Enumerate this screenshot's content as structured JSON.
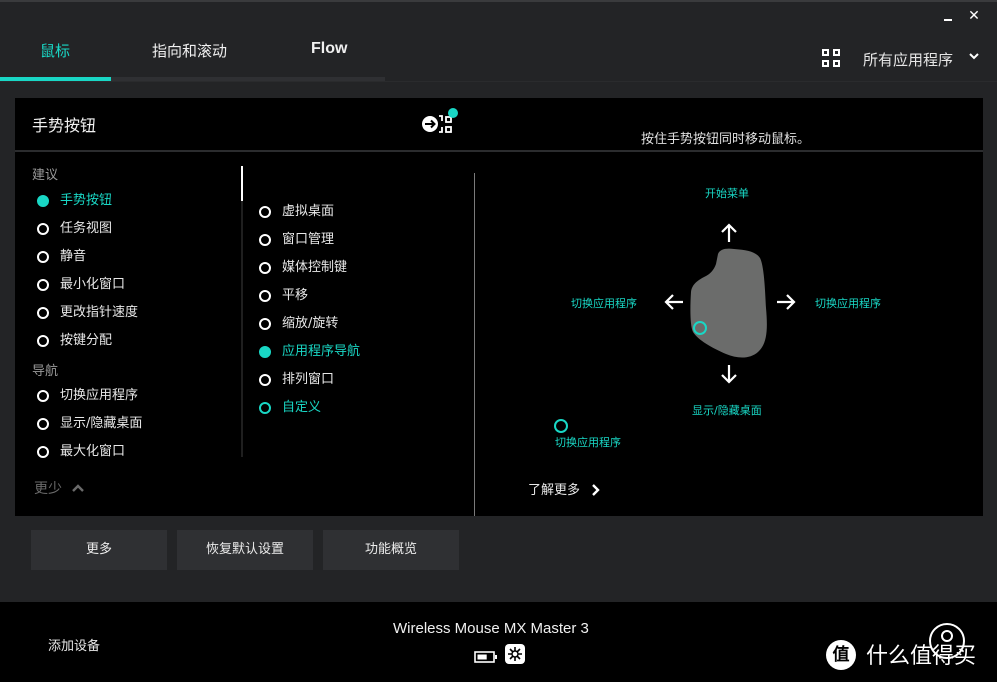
{
  "window": {
    "minimize_label": "minimize",
    "close_label": "✕"
  },
  "tabs": [
    {
      "label": "鼠标",
      "active": true
    },
    {
      "label": "指向和滚动",
      "active": false
    },
    {
      "label": "Flow",
      "active": false
    }
  ],
  "app_selector": {
    "label": "所有应用程序",
    "icon": "app-grid-icon",
    "chevron": "⌄"
  },
  "panel": {
    "title": "手势按钮",
    "hint": "按住手势按钮同时移动鼠标。",
    "left_list": {
      "sections": [
        {
          "label": "建议",
          "items": [
            {
              "label": "手势按钮",
              "selected": true
            },
            {
              "label": "任务视图",
              "selected": false
            },
            {
              "label": "静音",
              "selected": false
            },
            {
              "label": "最小化窗口",
              "selected": false
            },
            {
              "label": "更改指针速度",
              "selected": false
            },
            {
              "label": "按键分配",
              "selected": false
            }
          ]
        },
        {
          "label": "导航",
          "items": [
            {
              "label": "切换应用程序",
              "selected": false
            },
            {
              "label": "显示/隐藏桌面",
              "selected": false
            },
            {
              "label": "最大化窗口",
              "selected": false
            }
          ]
        }
      ],
      "less_label": "更少"
    },
    "middle_list": {
      "items": [
        {
          "label": "虚拟桌面",
          "state": "off"
        },
        {
          "label": "窗口管理",
          "state": "off"
        },
        {
          "label": "媒体控制键",
          "state": "off"
        },
        {
          "label": "平移",
          "state": "off"
        },
        {
          "label": "缩放/旋转",
          "state": "off"
        },
        {
          "label": "应用程序导航",
          "state": "selected"
        },
        {
          "label": "排列窗口",
          "state": "off"
        },
        {
          "label": "自定义",
          "state": "accent"
        }
      ]
    },
    "diagram": {
      "up": "开始菜单",
      "left": "切换应用程序",
      "right": "切换应用程序",
      "down": "显示/隐藏桌面",
      "click": "切换应用程序",
      "learn_more": "了解更多"
    }
  },
  "buttons": {
    "more": "更多",
    "reset": "恢复默认设置",
    "overview": "功能概览"
  },
  "footer": {
    "add_device": "添加设备",
    "device_name": "Wireless Mouse MX Master 3",
    "battery_level": 0.66,
    "watermark_badge": "值",
    "watermark_text": "什么值得买"
  },
  "colors": {
    "accent": "#19d7c5",
    "background": "#232426",
    "panel": "#000000",
    "button": "#2f3033",
    "mouse_body": "#6b6c6b"
  }
}
